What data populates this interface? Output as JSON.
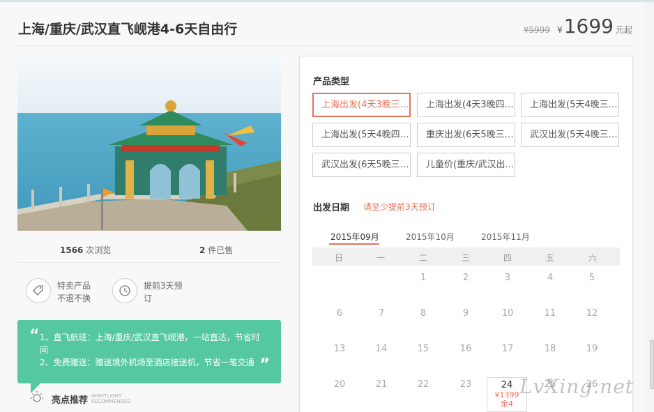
{
  "product": {
    "title": "上海/重庆/武汉直飞岘港4-6天自由行",
    "old_price": "¥5999",
    "currency": "¥",
    "price": "1699",
    "price_unit": "元起"
  },
  "stats": {
    "views_count": "1566",
    "views_label": "次浏览",
    "sold_count": "2",
    "sold_label": "件已售"
  },
  "features": [
    {
      "icon": "tag-icon",
      "line1": "特卖产品",
      "line2": "不退不换"
    },
    {
      "icon": "clock-icon",
      "line1": "提前3天预",
      "line2": "订"
    }
  ],
  "highlights": {
    "items": [
      "1、直飞航班：上海/重庆/武汉直飞岘港，一站直达，节省时间",
      "2、免费赠送：赠送境外机场至酒店接送机，节省一笔交通"
    ],
    "label": "亮点推荐",
    "label_en_1": "HIGHTLIGHT",
    "label_en_2": "RECOMMENDED",
    "color": "#56c8a1"
  },
  "product_types": {
    "title": "产品类型",
    "options": [
      {
        "label": "上海出发(4天3晚三…",
        "selected": true
      },
      {
        "label": "上海出发(4天3晚四…",
        "selected": false
      },
      {
        "label": "上海出发(5天4晚三…",
        "selected": false
      },
      {
        "label": "上海出发(5天4晚四…",
        "selected": false
      },
      {
        "label": "重庆出发(6天5晚三…",
        "selected": false
      },
      {
        "label": "武汉出发(5天4晚三…",
        "selected": false
      },
      {
        "label": "武汉出发(6天5晚三…",
        "selected": false
      },
      {
        "label": "儿童价(重庆/武汉出…",
        "selected": false
      }
    ]
  },
  "calendar": {
    "title": "出发日期",
    "notice": "请至少提前3天预订",
    "months": [
      "2015年09月",
      "2015年10月",
      "2015年11月"
    ],
    "active_month": "2015年09月",
    "weekdays": [
      "日",
      "一",
      "二",
      "三",
      "四",
      "五",
      "六"
    ],
    "days": [
      "1",
      "2",
      "3",
      "4",
      "5",
      "6",
      "7",
      "8",
      "9",
      "10",
      "11",
      "12",
      "13",
      "14",
      "15",
      "16",
      "17",
      "18",
      "19",
      "20",
      "21",
      "22",
      "23",
      "24",
      "25",
      "26"
    ],
    "available": {
      "day": "24",
      "price": "¥1399",
      "remaining": "余4"
    },
    "accent_color": "#e8705a"
  },
  "watermark": "LvXing.net"
}
